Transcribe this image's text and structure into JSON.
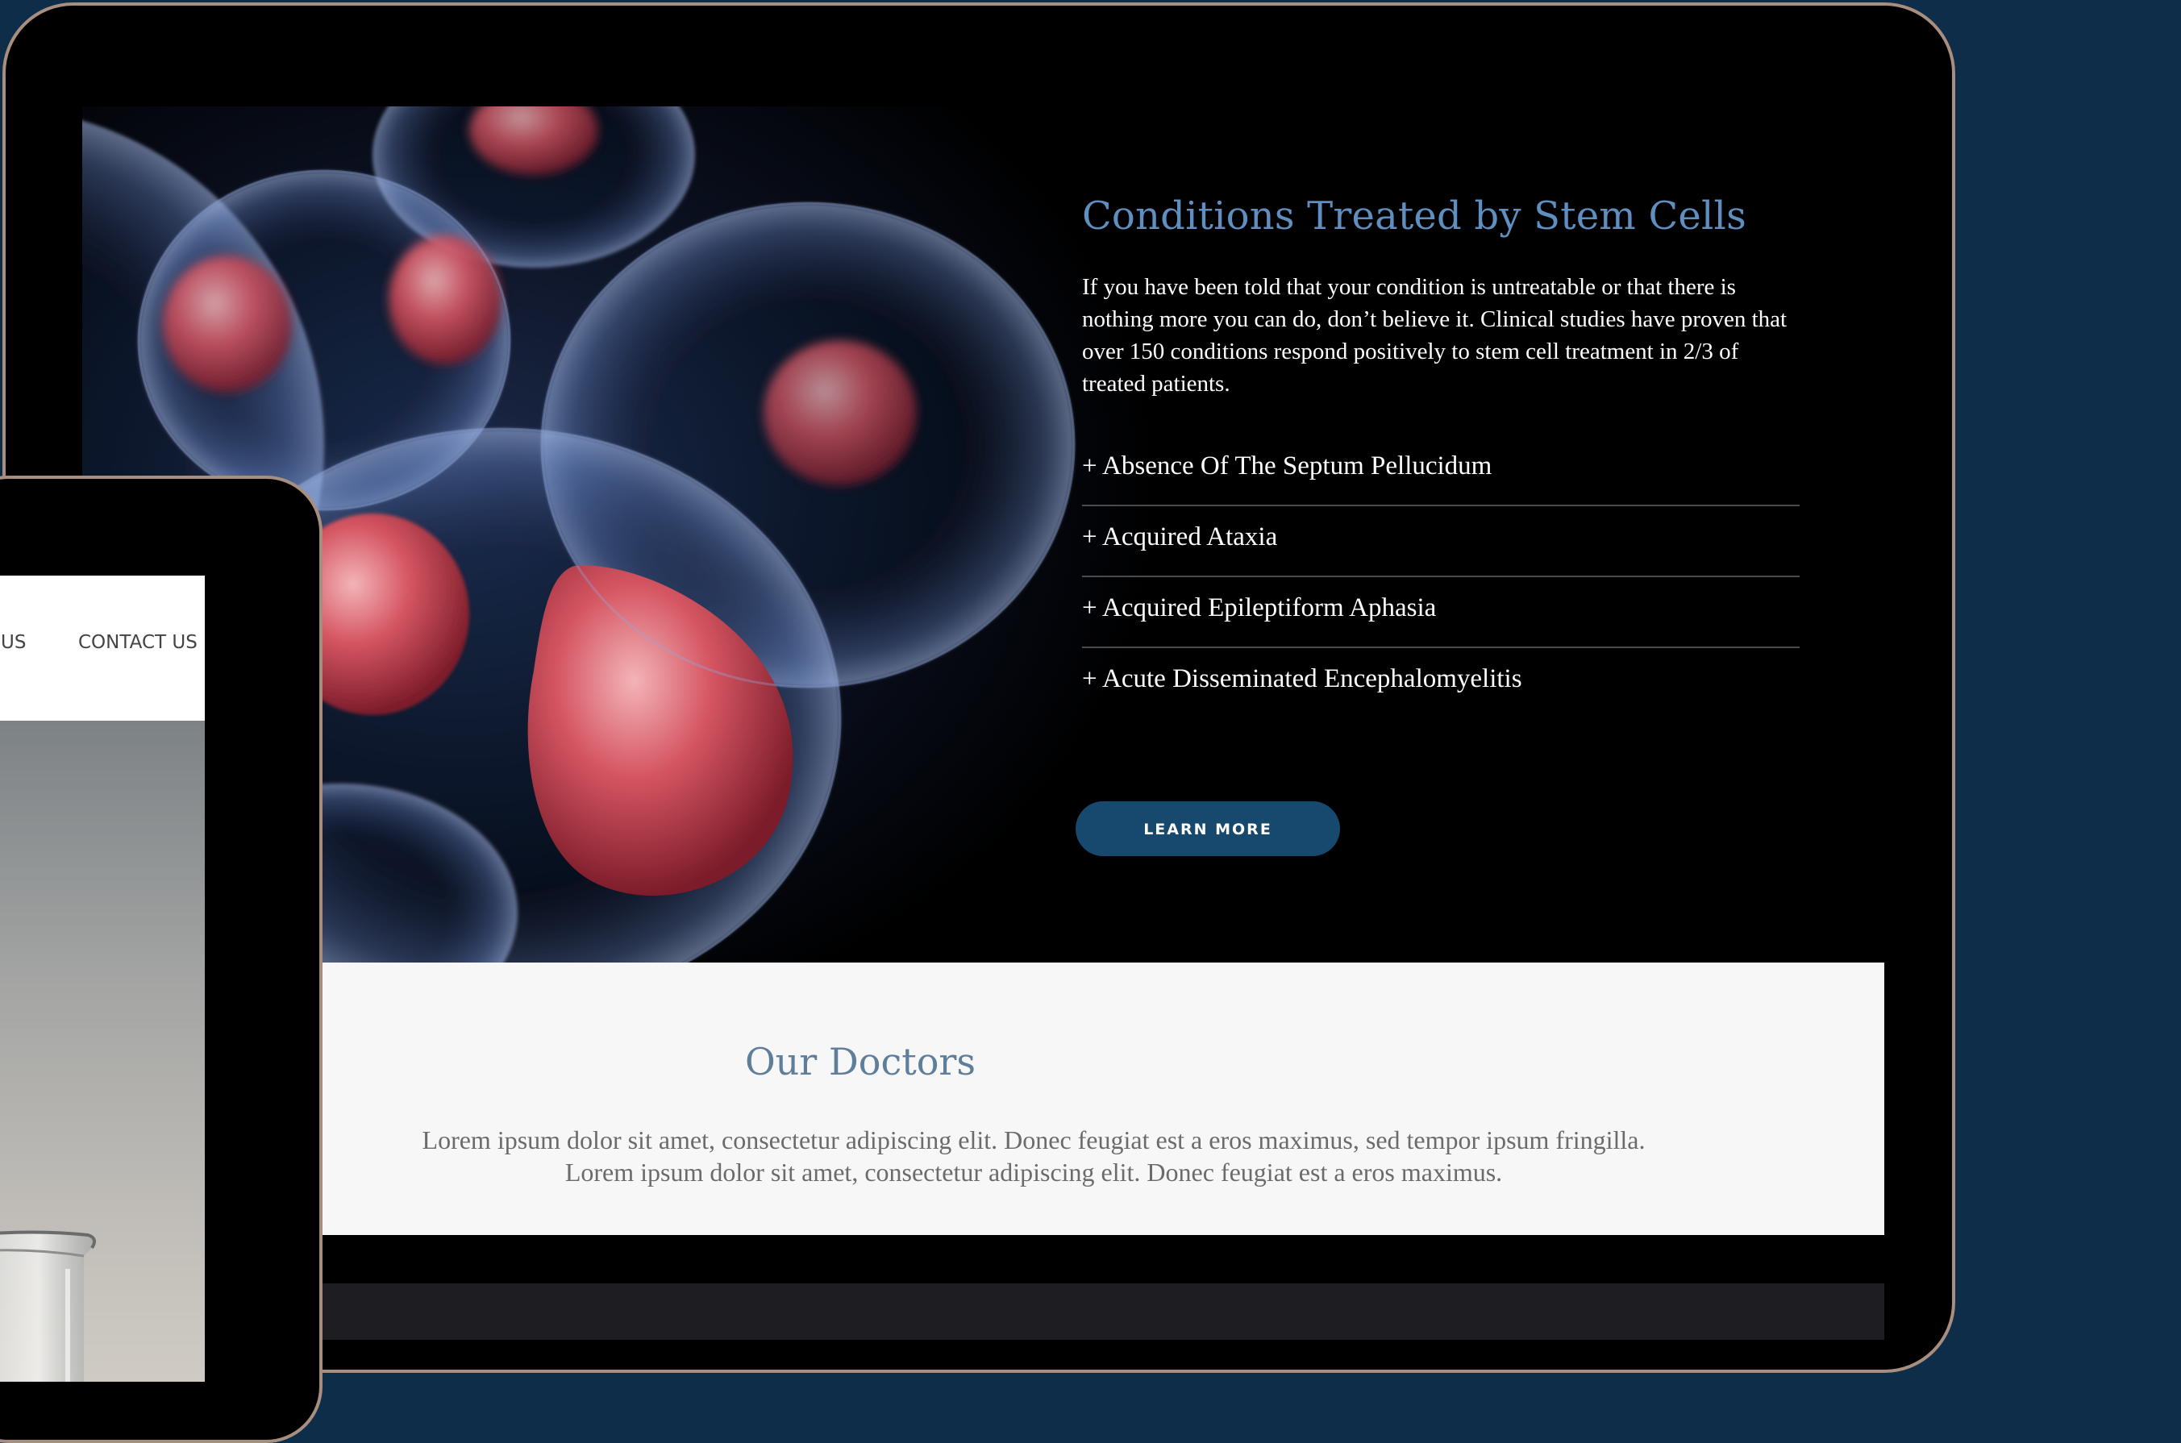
{
  "hero": {
    "title": "Conditions Treated by Stem Cells",
    "intro": "If you have been told that your condition is untreatable or that there is nothing more you can do, don’t believe it. Clinical studies have proven that over 150 conditions respond positively to stem cell treatment in 2/3 of treated patients.",
    "conditions": [
      "+ Absence Of The Septum Pellucidum",
      "+ Acquired Ataxia",
      "+ Acquired Epileptiform Aphasia",
      "+ Acute Disseminated Encephalomyelitis"
    ],
    "cta_label": "LEARN MORE"
  },
  "doctors": {
    "title": "Our Doctors",
    "text": "Lorem ipsum dolor sit amet, consectetur adipiscing elit. Donec feugiat est a eros maximus, sed tempor ipsum fringilla. Lorem ipsum dolor sit amet, consectetur adipiscing elit. Donec feugiat est a eros maximus."
  },
  "tablet": {
    "nav": {
      "partial_item": "US",
      "contact": "CONTACT US"
    }
  },
  "colors": {
    "background": "#0d2d48",
    "device_frame": "#a88e7e",
    "title_blue": "#5f8fc0",
    "button": "#17486e",
    "cell_red": "#c8424e"
  }
}
